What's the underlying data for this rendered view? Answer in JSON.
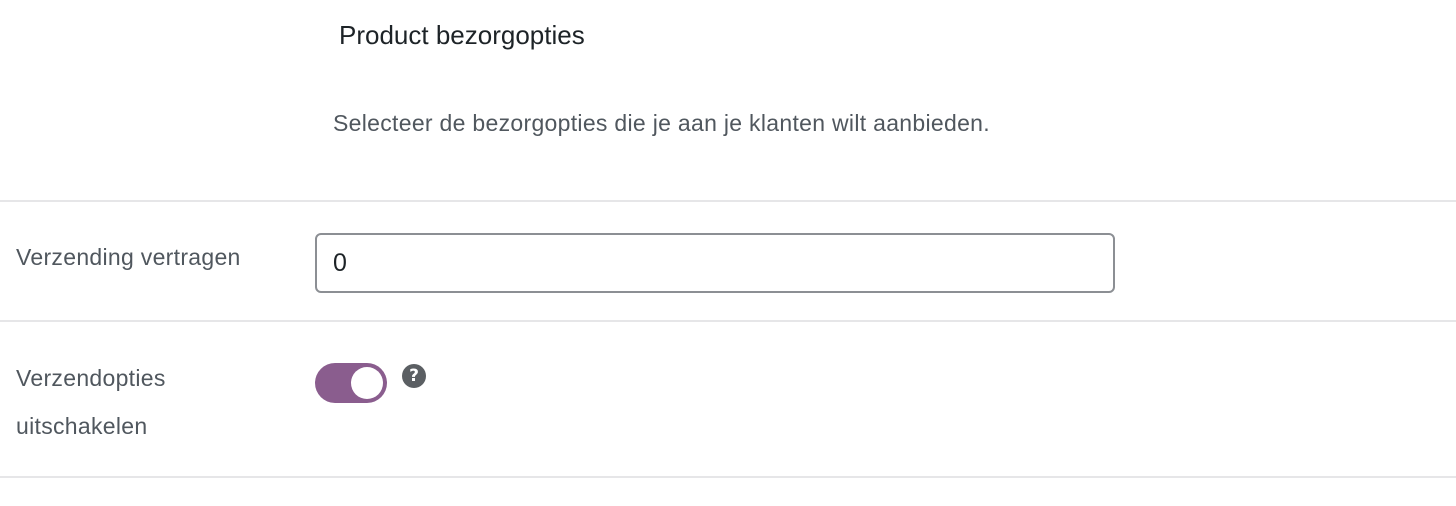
{
  "section": {
    "title": "Product bezorgopties",
    "description": "Selecteer de bezorgopties die je aan je klanten wilt aanbieden."
  },
  "fields": {
    "delay_shipping": {
      "label": "Verzending vertragen",
      "value": "0"
    },
    "disable_shipping_options": {
      "label": "Verzendopties uitschakelen",
      "enabled": true,
      "help_icon": "question-mark",
      "help_symbol": "?"
    }
  },
  "colors": {
    "toggle_on": "#8a5d8e",
    "help_icon": "#5b5f63",
    "divider": "#e6e6e8",
    "input_border": "#8c8f94"
  }
}
